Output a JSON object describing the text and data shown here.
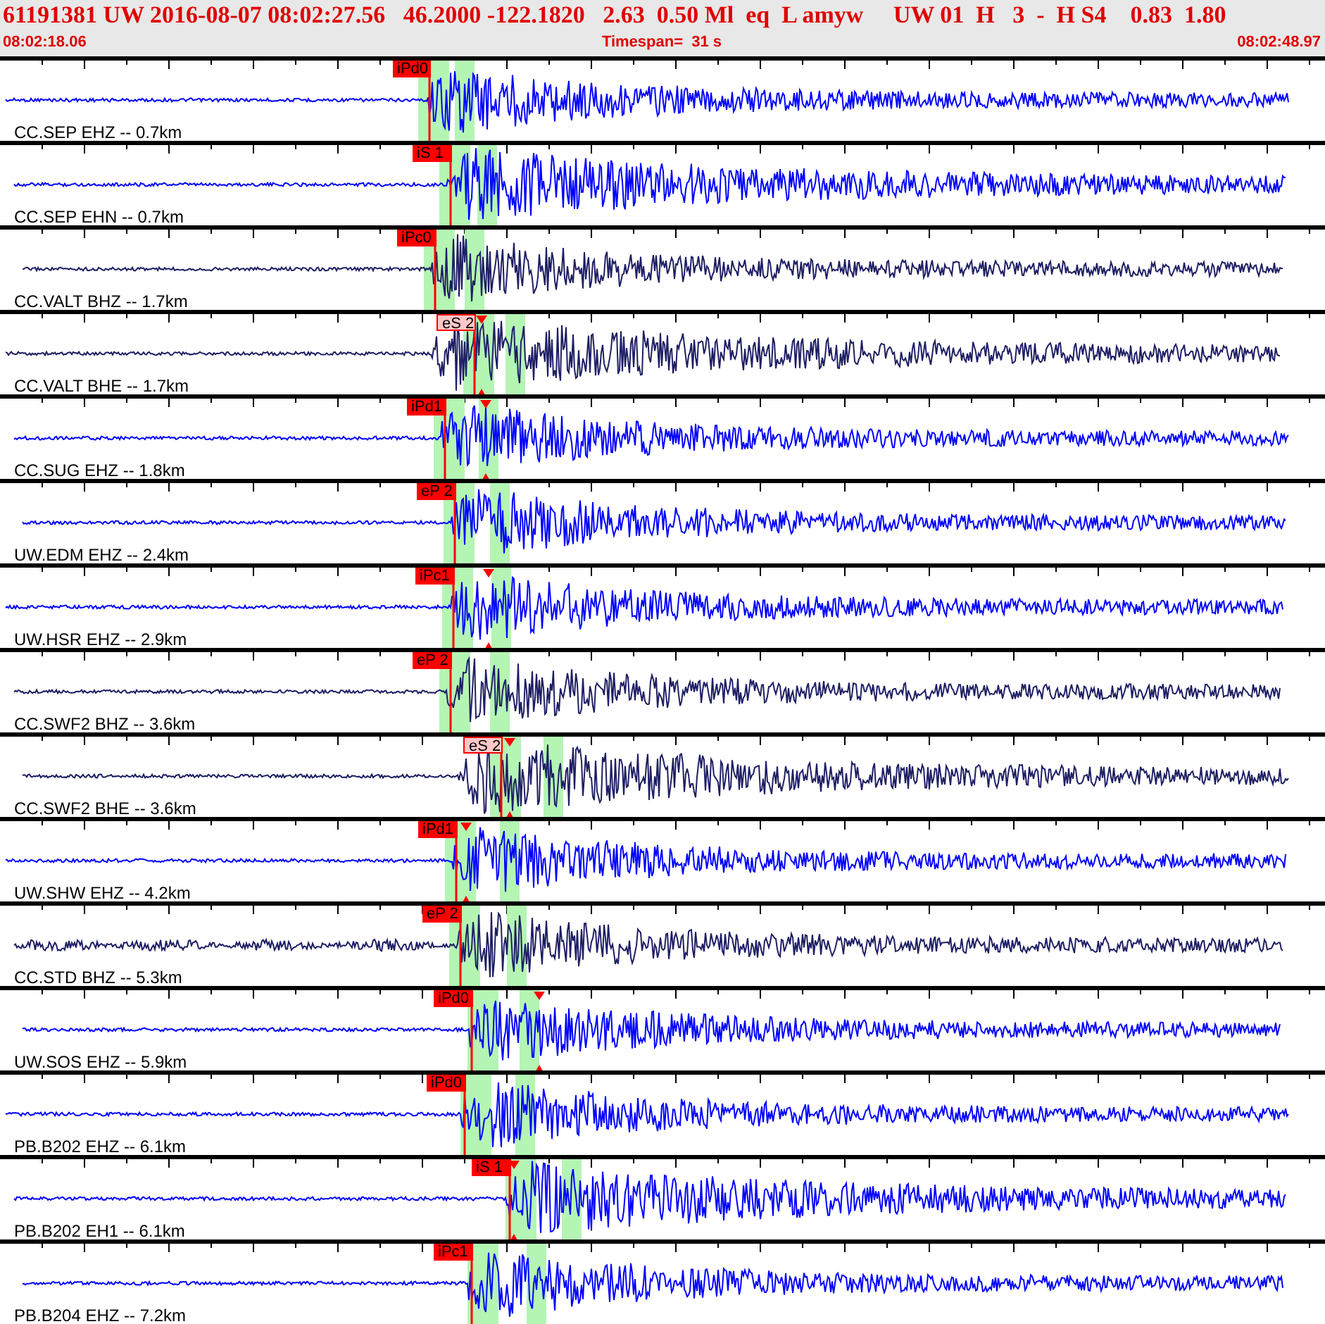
{
  "header": {
    "event_line": "61191381 UW 2016-08-07 08:02:27.56   46.2000 -122.1820   2.63  0.50 Ml  eq  L amyw     UW 01  H   3  -  H S4    0.83  1.80",
    "start_time": "08:02:18.06",
    "timespan": "Timespan=  31 s",
    "end_time": "08:02:48.97"
  },
  "traces": [
    {
      "label": "CC.SEP EHZ -- 0.7km",
      "color": "#0000ff",
      "pick": {
        "label": "iPd0",
        "kind": "impulsive"
      }
    },
    {
      "label": "CC.SEP EHN -- 0.7km",
      "color": "#0000ff",
      "pick": {
        "label": "iS 1",
        "kind": "impulsive"
      }
    },
    {
      "label": "CC.VALT BHZ -- 1.7km",
      "color": "#1e1e64",
      "pick": {
        "label": "iPc0",
        "kind": "impulsive"
      }
    },
    {
      "label": "CC.VALT BHE -- 1.7km",
      "color": "#1e1e64",
      "pick": {
        "label": "eS 2",
        "kind": "emergent"
      }
    },
    {
      "label": "CC.SUG EHZ -- 1.8km",
      "color": "#0000ff",
      "pick": {
        "label": "iPd1",
        "kind": "impulsive"
      }
    },
    {
      "label": "UW.EDM EHZ -- 2.4km",
      "color": "#0000ff",
      "pick": {
        "label": "eP 2",
        "kind": "impulsive"
      }
    },
    {
      "label": "UW.HSR EHZ -- 2.9km",
      "color": "#0000ff",
      "pick": {
        "label": "iPc1",
        "kind": "impulsive"
      }
    },
    {
      "label": "CC.SWF2 BHZ -- 3.6km",
      "color": "#1e1e64",
      "pick": {
        "label": "eP 2",
        "kind": "impulsive"
      }
    },
    {
      "label": "CC.SWF2 BHE -- 3.6km",
      "color": "#1e1e64",
      "pick": {
        "label": "eS 2",
        "kind": "emergent"
      }
    },
    {
      "label": "UW.SHW EHZ -- 4.2km",
      "color": "#0000ff",
      "pick": {
        "label": "iPd1",
        "kind": "impulsive"
      }
    },
    {
      "label": "CC.STD BHZ -- 5.3km",
      "color": "#1e1e64",
      "pick": {
        "label": "eP 2",
        "kind": "impulsive"
      }
    },
    {
      "label": "UW.SOS EHZ -- 5.9km",
      "color": "#0000ff",
      "pick": {
        "label": "iPd0",
        "kind": "impulsive"
      }
    },
    {
      "label": "PB.B202 EHZ -- 6.1km",
      "color": "#0000ff",
      "pick": {
        "label": "iPd0",
        "kind": "impulsive"
      }
    },
    {
      "label": "PB.B202 EH1 -- 6.1km",
      "color": "#0000ff",
      "pick": {
        "label": "iS 1",
        "kind": "impulsive"
      }
    },
    {
      "label": "PB.B204 EHZ -- 7.2km",
      "color": "#0000ff",
      "pick": {
        "label": "iPc1",
        "kind": "impulsive"
      }
    }
  ]
}
